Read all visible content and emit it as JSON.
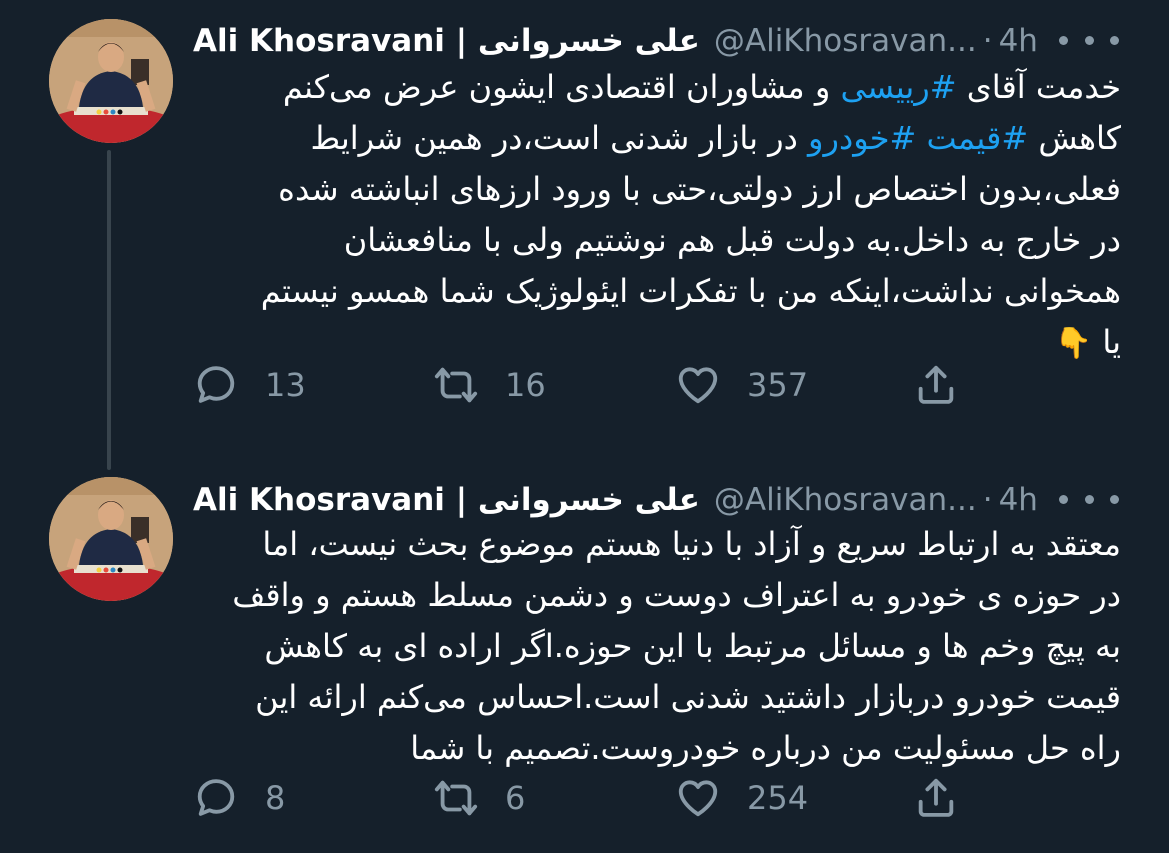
{
  "tweets": [
    {
      "author_name": "Ali Khosravani | علی خسروانی",
      "handle": "@AliKhosravan...",
      "separator": "·",
      "time": "4h",
      "lines": [
        [
          {
            "text": "خدمت آقای "
          },
          {
            "text": "#رییسی",
            "hashtag": true
          },
          {
            "text": " و مشاوران اقتصادی ایشون عرض می‌کنم"
          }
        ],
        [
          {
            "text": "کاهش "
          },
          {
            "text": "#قیمت",
            "hashtag": true
          },
          {
            "text": " "
          },
          {
            "text": "#خودرو",
            "hashtag": true
          },
          {
            "text": " در بازار شدنی است،در همین شرایط"
          }
        ],
        [
          {
            "text": "فعلی،بدون اختصاص ارز دولتی،حتی با ورود ارزهای انباشته شده"
          }
        ],
        [
          {
            "text": "در خارج به داخل.به دولت قبل هم نوشتیم ولی با منافعشان"
          }
        ],
        [
          {
            "text": "همخوانی نداشت،اینکه من با تفکرات ایئولوژیک شما همسو نیستم"
          }
        ],
        [
          {
            "text": "یا "
          },
          {
            "text": "👇",
            "emoji": true
          }
        ]
      ],
      "replies": "13",
      "retweets": "16",
      "likes": "357"
    },
    {
      "author_name": "Ali Khosravani | علی خسروانی",
      "handle": "@AliKhosravan...",
      "separator": "·",
      "time": "4h",
      "lines": [
        [
          {
            "text": "معتقد به ارتباط سریع و آزاد با دنیا هستم موضوع بحث نیست، اما"
          }
        ],
        [
          {
            "text": "در حوزه ی خودرو به اعتراف دوست و دشمن مسلط هستم و واقف"
          }
        ],
        [
          {
            "text": "به پیچ وخم ها و مسائل مرتبط با این حوزه.اگر اراده ای به کاهش"
          }
        ],
        [
          {
            "text": "قیمت خودرو دربازار داشتید شدنی است.احساس می‌کنم ارائه این"
          }
        ],
        [
          {
            "text": "راه حل مسئولیت من درباره خودروست.تصمیم با شما"
          }
        ]
      ],
      "replies": "8",
      "retweets": "6",
      "likes": "254"
    }
  ],
  "colors": {
    "background": "#15202b",
    "text": "#ffffff",
    "muted": "#8899a6",
    "hashtag": "#1da1f2",
    "thread_line": "#38444d"
  },
  "icons": [
    "avatar",
    "more-icon",
    "reply-icon",
    "retweet-icon",
    "like-icon",
    "share-icon"
  ]
}
